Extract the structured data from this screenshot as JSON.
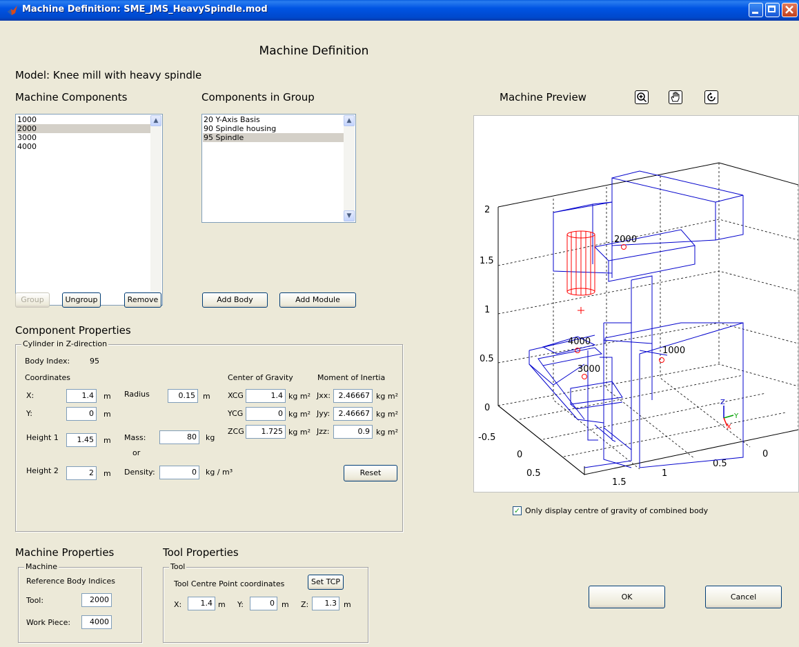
{
  "window": {
    "title": "Machine Definition: SME_JMS_HeavySpindle.mod"
  },
  "header": {
    "title": "Machine Definition",
    "model_label": "Model: Knee mill with heavy spindle"
  },
  "machine_components": {
    "label": "Machine Components",
    "items": [
      "1000",
      "2000",
      "3000",
      "4000"
    ],
    "selected": "2000",
    "group_button": "Group",
    "ungroup_button": "Ungroup",
    "remove_button": "Remove"
  },
  "components_in_group": {
    "label": "Components in Group",
    "items": [
      "20 Y-Axis Basis",
      "90 Spindle housing",
      "95 Spindle"
    ],
    "selected": "95 Spindle",
    "add_body_button": "Add Body",
    "add_module_button": "Add Module"
  },
  "component_properties": {
    "label": "Component Properties",
    "frame_title": "Cylinder in Z-direction",
    "body_index_label": "Body Index:",
    "body_index_value": "95",
    "coordinates_label": "Coordinates",
    "x_label": "X:",
    "x_value": "1.4",
    "x_unit": "m",
    "y_label": "Y:",
    "y_value": "0",
    "y_unit": "m",
    "height1_label": "Height 1",
    "height1_value": "1.45",
    "height1_unit": "m",
    "height2_label": "Height 2",
    "height2_value": "2",
    "height2_unit": "m",
    "radius_label": "Radius",
    "radius_value": "0.15",
    "radius_unit": "m",
    "mass_label": "Mass:",
    "mass_value": "80",
    "mass_unit": "kg",
    "or_label": "or",
    "density_label": "Density:",
    "density_value": "0",
    "density_unit": "kg / m³",
    "cog_label": "Center of Gravity",
    "xcg_label": "XCG",
    "xcg_value": "1.4",
    "xcg_unit": "kg m²",
    "ycg_label": "YCG",
    "ycg_value": "0",
    "ycg_unit": "kg m²",
    "zcg_label": "ZCG",
    "zcg_value": "1.725",
    "zcg_unit": "kg m²",
    "moi_label": "Moment of Inertia",
    "jxx_label": "Jxx:",
    "jxx_value": "2.46667",
    "jxx_unit": "kg m²",
    "jyy_label": "Jyy:",
    "jyy_value": "2.46667",
    "jyy_unit": "kg m²",
    "jzz_label": "Jzz:",
    "jzz_value": "0.9",
    "jzz_unit": "kg m²",
    "reset_button": "Reset"
  },
  "machine_properties": {
    "label": "Machine Properties",
    "frame_title": "Machine",
    "ref_label": "Reference Body Indices",
    "tool_label": "Tool:",
    "tool_value": "2000",
    "workpiece_label": "Work Piece:",
    "workpiece_value": "4000"
  },
  "tool_properties": {
    "label": "Tool Properties",
    "frame_title": "Tool",
    "tcp_label": "Tool Centre Point coordinates",
    "set_tcp_button": "Set TCP",
    "x_label": "X:",
    "x_value": "1.4",
    "x_unit": "m",
    "y_label": "Y:",
    "y_value": "0",
    "y_unit": "m",
    "z_label": "Z:",
    "z_value": "1.3",
    "z_unit": "m"
  },
  "preview": {
    "label": "Machine Preview",
    "tools": [
      "zoom-icon",
      "pan-icon",
      "rotate-icon"
    ],
    "z_ticks": [
      "2",
      "1.5",
      "1",
      "0.5",
      "0"
    ],
    "y_ticks": [
      "-0.5",
      "0",
      "0.5"
    ],
    "x_ticks": [
      "1.5",
      "1",
      "0.5",
      "0"
    ],
    "body_labels": [
      "2000",
      "4000",
      "1000",
      "3000"
    ],
    "axis_triad": {
      "z": "Z",
      "y": "Y",
      "x": "X"
    },
    "checkbox_label": "Only display centre of gravity of combined body",
    "checkbox_checked": true,
    "colors": {
      "bodies": "#0000cc",
      "selected": "#ff0000"
    }
  },
  "dialog": {
    "ok_button": "OK",
    "cancel_button": "Cancel"
  }
}
